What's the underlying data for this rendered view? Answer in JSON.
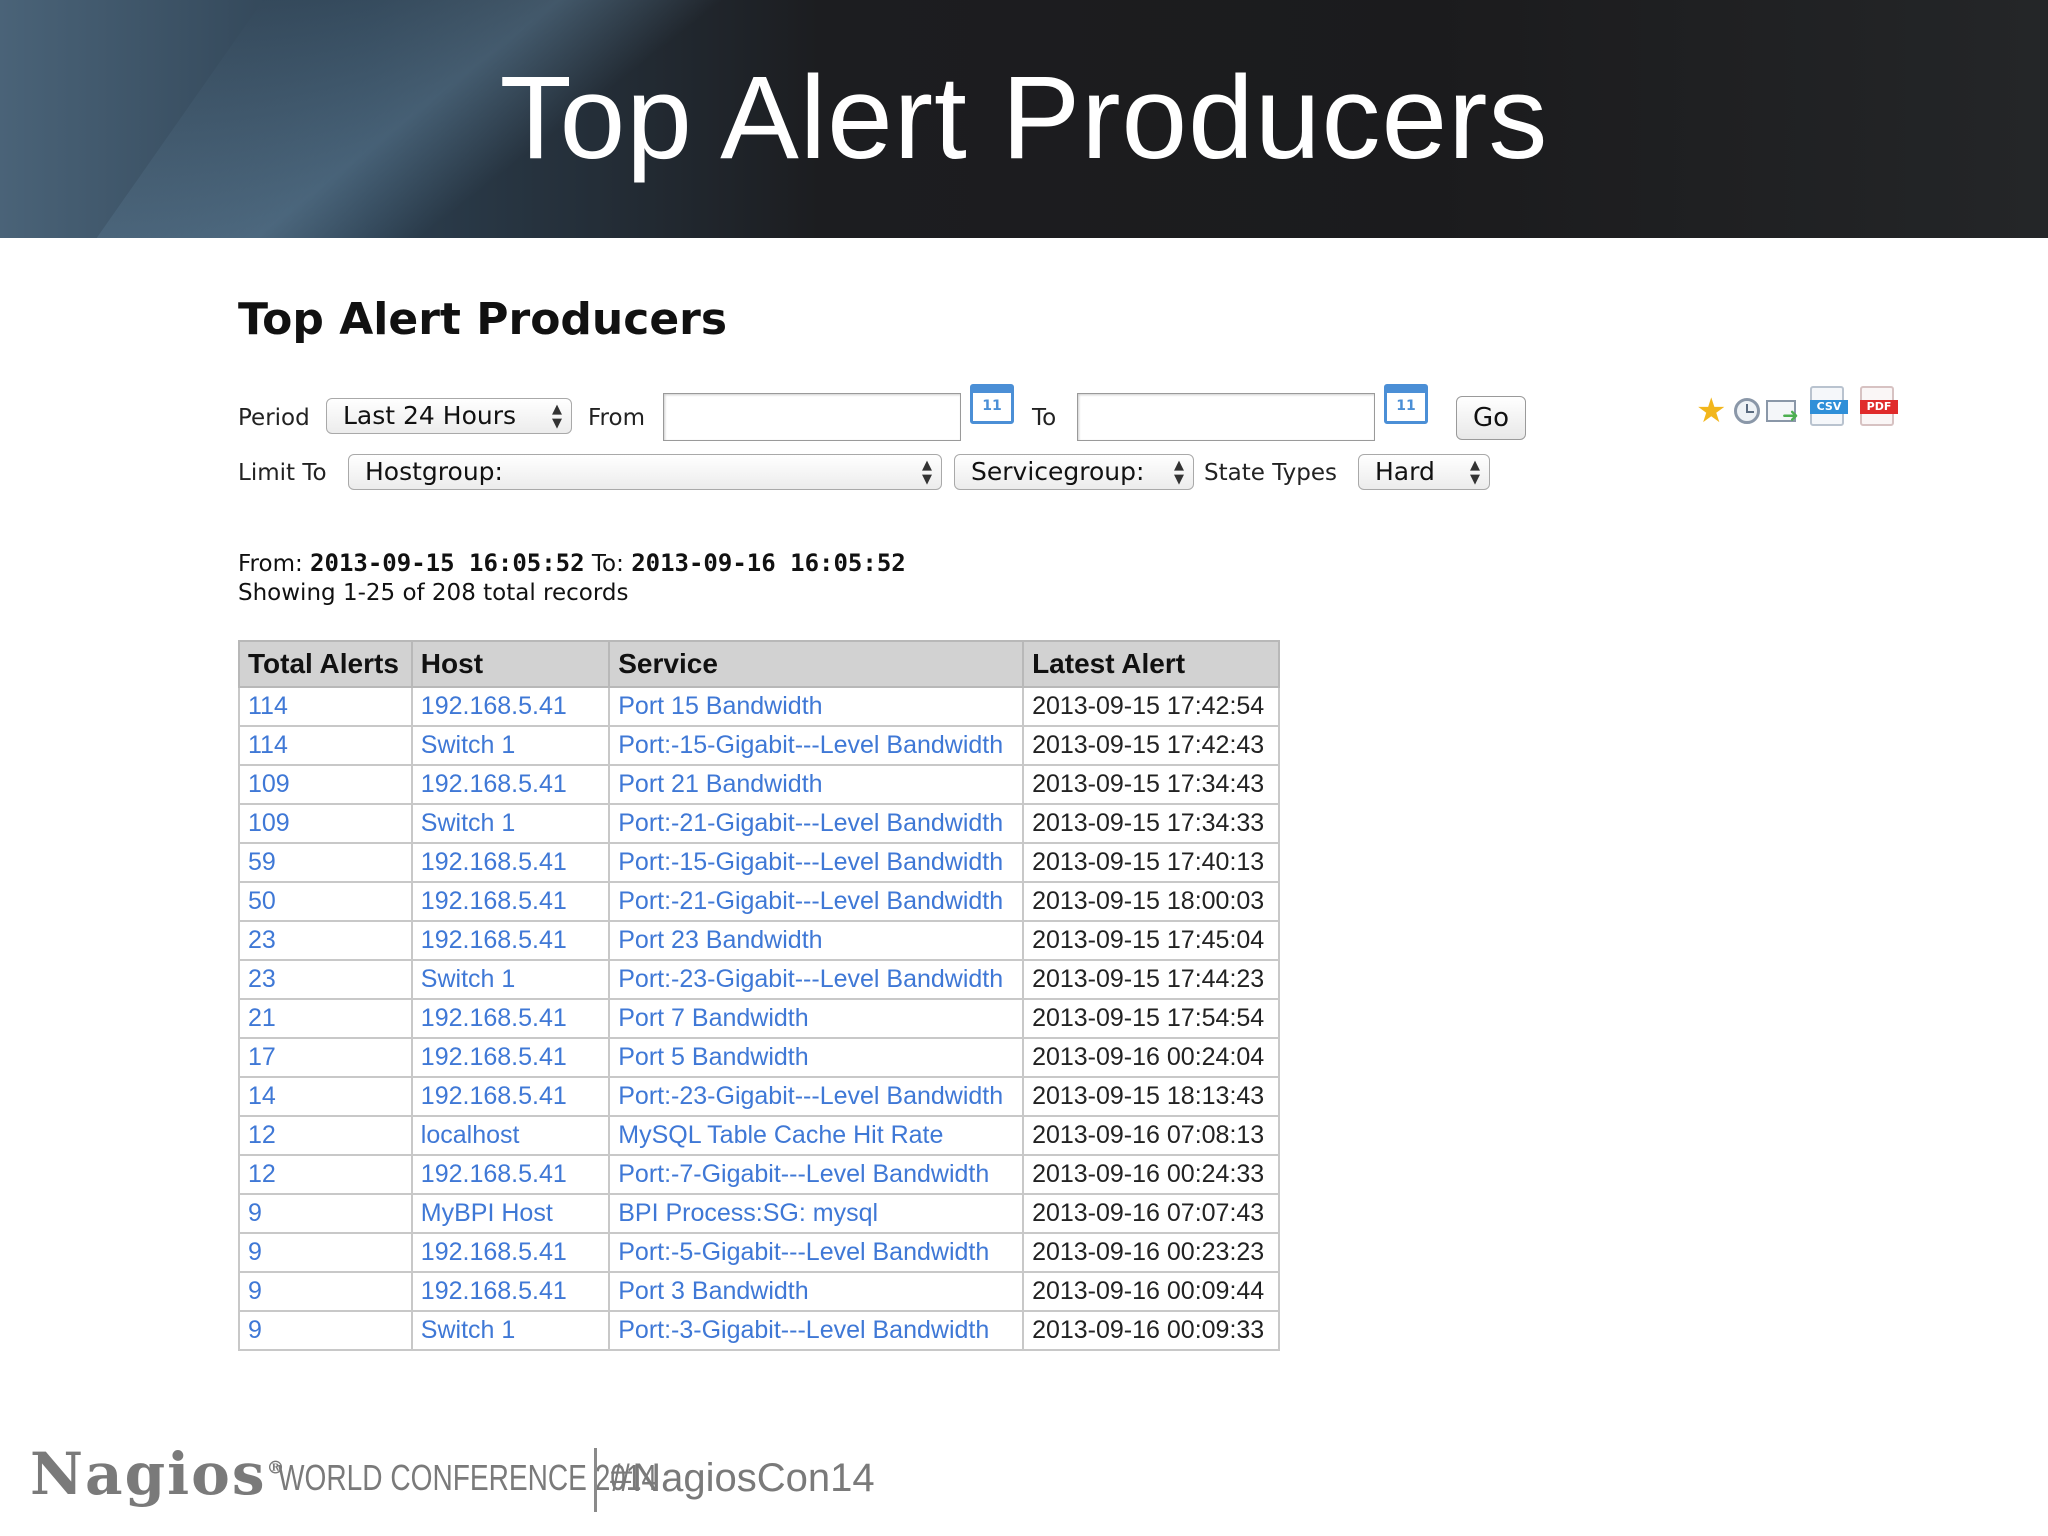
{
  "slide": {
    "banner_title": "Top Alert Producers",
    "footer_logo": "Nagios",
    "footer_reg": "®",
    "footer_conference": "WORLD CONFERENCE 2014",
    "footer_hashtag": "#NagiosCon14"
  },
  "page": {
    "title": "Top Alert Producers"
  },
  "filters": {
    "period_label": "Period",
    "period_value": "Last 24 Hours",
    "from_label": "From",
    "from_value": "",
    "to_label": "To",
    "to_value": "",
    "calendar_day": "11",
    "go_label": "Go",
    "limit_label": "Limit To",
    "hostgroup_value": "Hostgroup:",
    "servicegroup_value": "Servicegroup:",
    "state_types_label": "State Types",
    "state_types_value": "Hard"
  },
  "toolbar": {
    "icons": [
      "star-icon",
      "clock-icon",
      "email-icon",
      "csv-icon",
      "pdf-icon"
    ],
    "csv_text": "CSV",
    "pdf_text": "PDF"
  },
  "summary": {
    "from_prefix": "From:",
    "from_value": "2013-09-15 16:05:52",
    "to_prefix": "To:",
    "to_value": "2013-09-16 16:05:52",
    "showing": "Showing 1-25 of 208 total records"
  },
  "table": {
    "headers": [
      "Total Alerts",
      "Host",
      "Service",
      "Latest Alert"
    ],
    "rows": [
      [
        "114",
        "192.168.5.41",
        "Port 15 Bandwidth",
        "2013-09-15 17:42:54"
      ],
      [
        "114",
        "Switch 1",
        "Port:-15-Gigabit---Level Bandwidth",
        "2013-09-15 17:42:43"
      ],
      [
        "109",
        "192.168.5.41",
        "Port 21 Bandwidth",
        "2013-09-15 17:34:43"
      ],
      [
        "109",
        "Switch 1",
        "Port:-21-Gigabit---Level Bandwidth",
        "2013-09-15 17:34:33"
      ],
      [
        "59",
        "192.168.5.41",
        "Port:-15-Gigabit---Level Bandwidth",
        "2013-09-15 17:40:13"
      ],
      [
        "50",
        "192.168.5.41",
        "Port:-21-Gigabit---Level Bandwidth",
        "2013-09-15 18:00:03"
      ],
      [
        "23",
        "192.168.5.41",
        "Port 23 Bandwidth",
        "2013-09-15 17:45:04"
      ],
      [
        "23",
        "Switch 1",
        "Port:-23-Gigabit---Level Bandwidth",
        "2013-09-15 17:44:23"
      ],
      [
        "21",
        "192.168.5.41",
        "Port 7 Bandwidth",
        "2013-09-15 17:54:54"
      ],
      [
        "17",
        "192.168.5.41",
        "Port 5 Bandwidth",
        "2013-09-16 00:24:04"
      ],
      [
        "14",
        "192.168.5.41",
        "Port:-23-Gigabit---Level Bandwidth",
        "2013-09-15 18:13:43"
      ],
      [
        "12",
        "localhost",
        "MySQL Table Cache Hit Rate",
        "2013-09-16 07:08:13"
      ],
      [
        "12",
        "192.168.5.41",
        "Port:-7-Gigabit---Level Bandwidth",
        "2013-09-16 00:24:33"
      ],
      [
        "9",
        "MyBPI Host",
        "BPI Process:SG: mysql",
        "2013-09-16 07:07:43"
      ],
      [
        "9",
        "192.168.5.41",
        "Port:-5-Gigabit---Level Bandwidth",
        "2013-09-16 00:23:23"
      ],
      [
        "9",
        "192.168.5.41",
        "Port 3 Bandwidth",
        "2013-09-16 00:09:44"
      ],
      [
        "9",
        "Switch 1",
        "Port:-3-Gigabit---Level Bandwidth",
        "2013-09-16 00:09:33"
      ]
    ]
  }
}
